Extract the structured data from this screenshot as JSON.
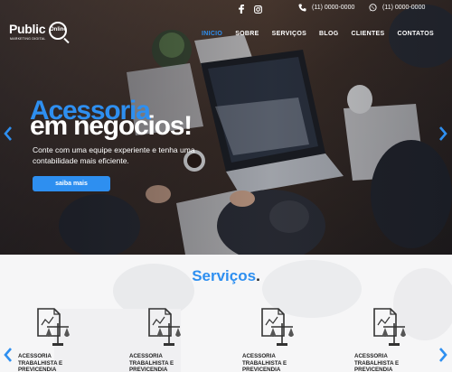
{
  "header": {
    "logo": {
      "word": "Public",
      "online": "Online",
      "sub": "MARKETING DIGITAL"
    },
    "social": [
      {
        "name": "facebook-icon"
      },
      {
        "name": "instagram-icon"
      }
    ],
    "phone": "(11) 0000-0000",
    "whatsapp": "(11) 0000-0000"
  },
  "nav": {
    "items": [
      {
        "label": "INICIO",
        "active": true
      },
      {
        "label": "SOBRE"
      },
      {
        "label": "SERVIÇOS"
      },
      {
        "label": "BLOG"
      },
      {
        "label": "CLIENTES"
      },
      {
        "label": "CONTATOS"
      }
    ]
  },
  "hero": {
    "headline_line1": "Acessoria",
    "headline_line2": "em negocios!",
    "tagline": "Conte com uma equipe experiente e tenha uma contabilidade mais eficiente.",
    "cta": "saiba mais"
  },
  "services": {
    "title": "Serviços",
    "title_dot": ".",
    "cards": [
      {
        "label": "ACESSORIA TRABALHISTA E PREVICENDIA"
      },
      {
        "label": "ACESSORIA TRABALHISTA E PREVICENDIA"
      },
      {
        "label": "ACESSORIA TRABALHISTA E PREVICENDIA"
      },
      {
        "label": "ACESSORIA TRABALHISTA E PREVICENDIA"
      }
    ]
  },
  "colors": {
    "accent": "#2e8ff0",
    "dark": "#222222"
  }
}
